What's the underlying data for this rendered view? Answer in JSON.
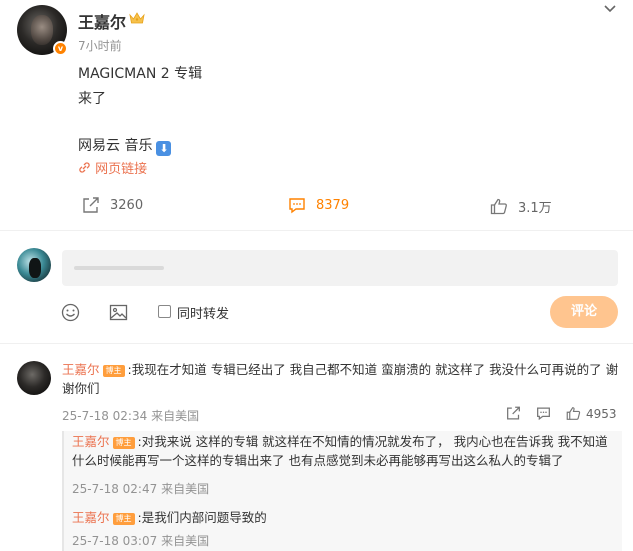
{
  "post": {
    "author": "王嘉尔",
    "verified_badge": "v",
    "crown_icon": "crown-icon",
    "time": "7小时前",
    "line1": "MAGICMAN 2 专辑",
    "line2": "来了",
    "line3": "网易云 音乐",
    "download_icon": "⬇",
    "web_link": "网页链接",
    "link_icon": "link-icon",
    "repost_count": "3260",
    "comment_count": "8379",
    "like_count": "3.1万"
  },
  "composer": {
    "also_repost_label": "同时转发",
    "submit_label": "评论"
  },
  "comments": [
    {
      "name": "王嘉尔",
      "tag": "博主",
      "text": ":我现在才知道 专辑已经出了 我自己都不知道 蛮崩溃的  就这样了 我没什么可再说的了  谢谢你们",
      "time": "25-7-18 02:34",
      "source": "来自美国",
      "likes": "4953"
    }
  ],
  "replies": [
    {
      "name": "王嘉尔",
      "tag": "博主",
      "text": ":对我来说 这样的专辑 就这样在不知情的情况就发布了，  我内心也在告诉我 我不知道什么时候能再写一个这样的专辑出来了 也有点感觉到未必再能够再写出这么私人的专辑了",
      "time": "25-7-18 02:47",
      "source": "来自美国"
    },
    {
      "name": "王嘉尔",
      "tag": "博主",
      "text": ":是我们内部问题导致的",
      "time": "25-7-18 03:07",
      "source": "来自美国"
    }
  ],
  "colors": {
    "accent": "#ff8200",
    "link": "#eb7350",
    "submit_disabled": "#ffc58f",
    "muted": "#939393"
  }
}
